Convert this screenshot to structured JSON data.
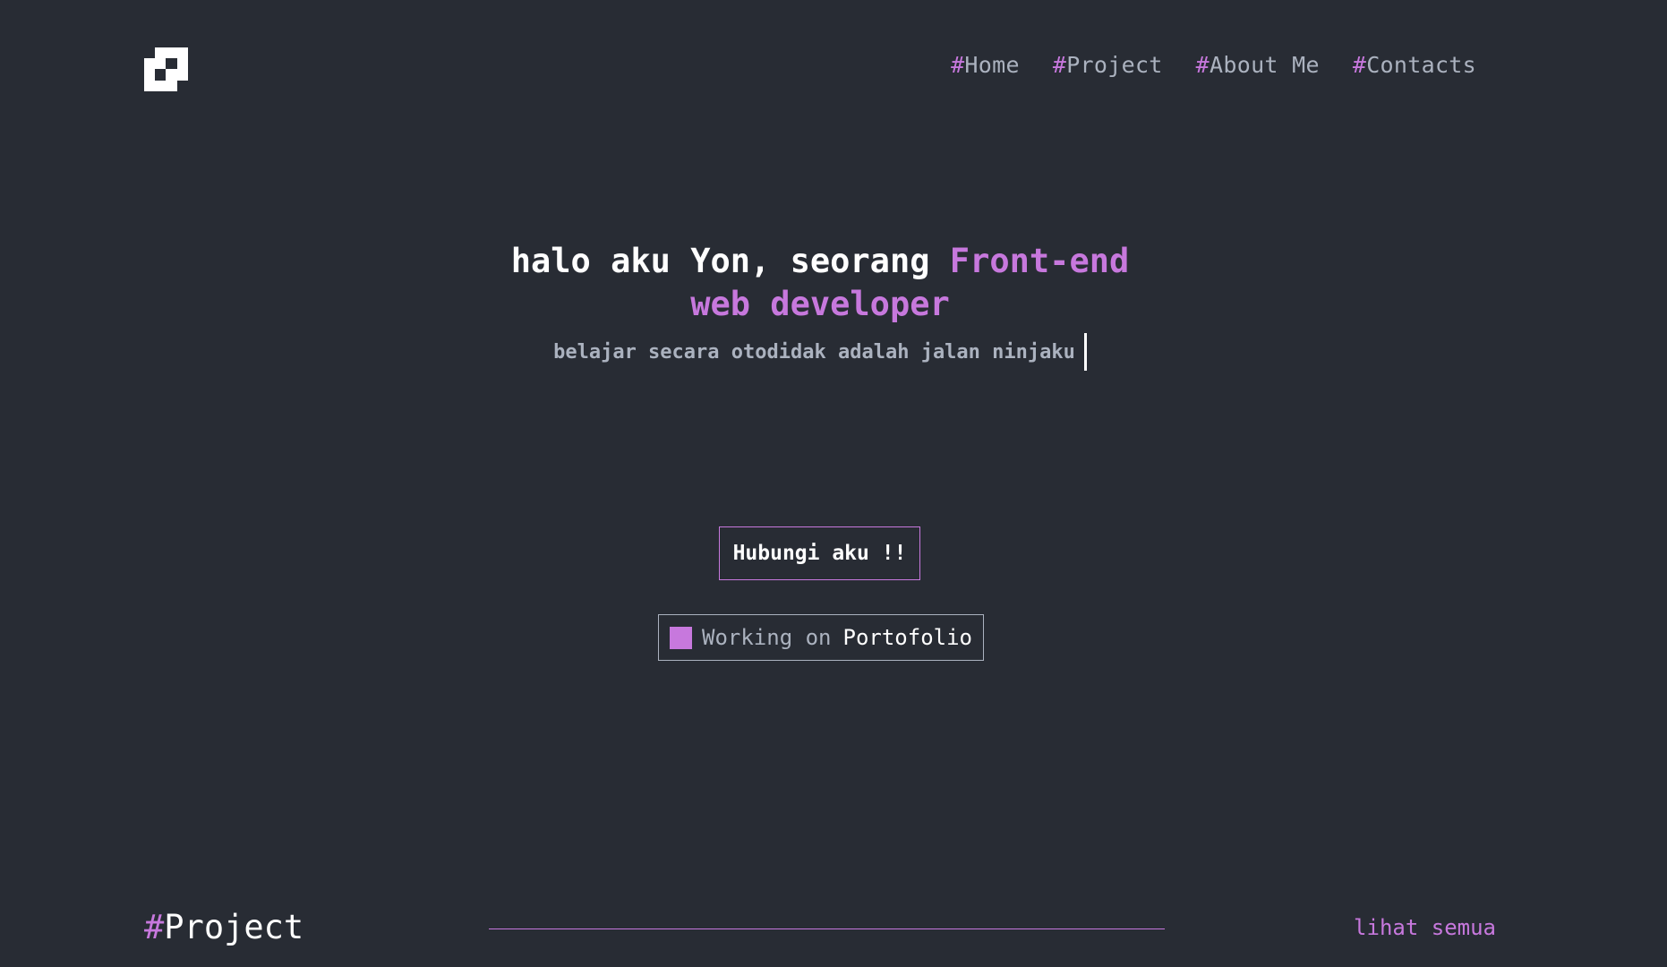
{
  "header": {
    "logo_icon": "pixel-logo-icon",
    "nav": [
      {
        "hash": "#",
        "label": "Home"
      },
      {
        "hash": "#",
        "label": "Project"
      },
      {
        "hash": "#",
        "label": "About Me"
      },
      {
        "hash": "#",
        "label": "Contacts"
      }
    ]
  },
  "hero": {
    "title_prefix": "halo aku Yon, seorang ",
    "title_accent_line1": "Front-end",
    "title_accent_line2": "web developer",
    "subtitle": "belajar secara otodidak adalah jalan ninjaku",
    "contact_button": "Hubungi aku !!",
    "status_prefix": "Working on",
    "status_project": "Portofolio"
  },
  "section": {
    "hash": "#",
    "title": "Project",
    "see_all": "lihat semua"
  },
  "colors": {
    "background": "#282c34",
    "accent": "#c778dd",
    "text": "#abb2bf",
    "white": "#ffffff"
  }
}
